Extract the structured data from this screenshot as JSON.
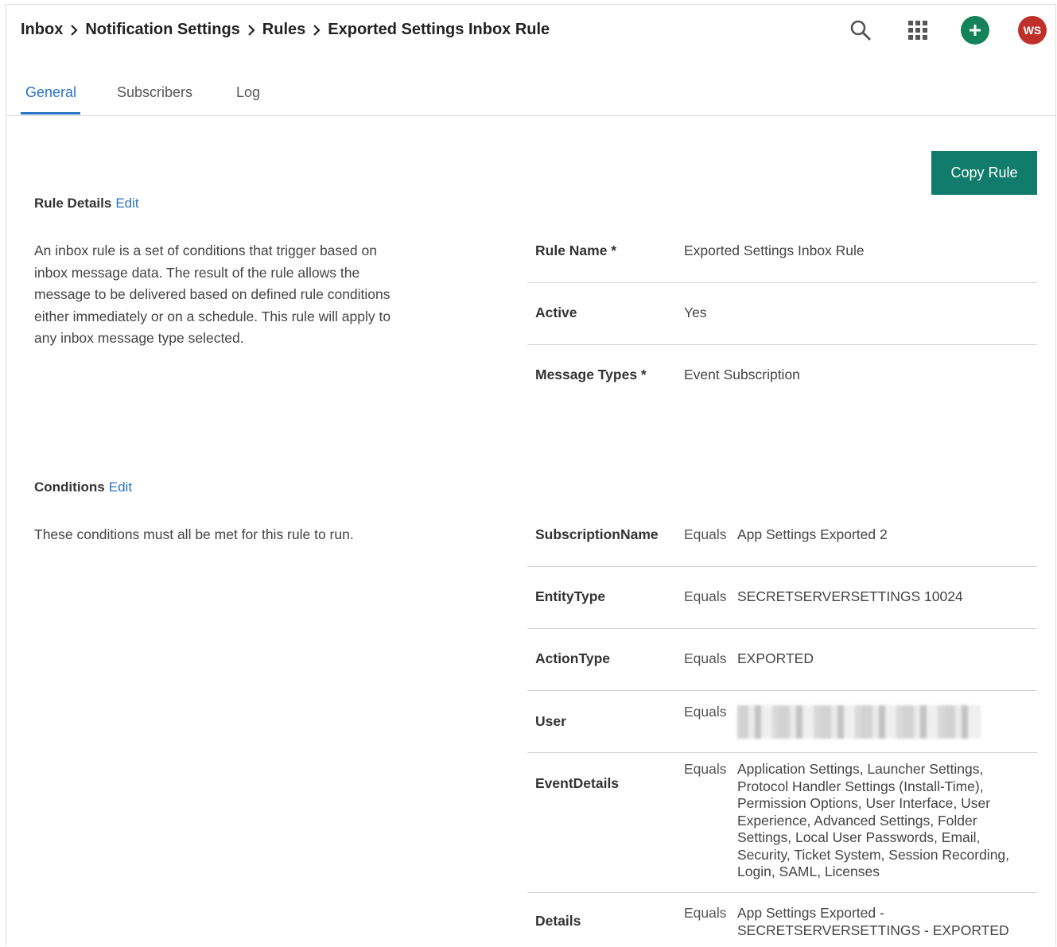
{
  "header": {
    "breadcrumb": [
      "Inbox",
      "Notification Settings",
      "Rules",
      "Exported Settings Inbox Rule"
    ],
    "avatar_initials": "WS",
    "icons": [
      "search-icon",
      "app-grid-icon",
      "add-icon"
    ]
  },
  "tabs": [
    {
      "label": "General",
      "active": true
    },
    {
      "label": "Subscribers",
      "active": false
    },
    {
      "label": "Log",
      "active": false
    }
  ],
  "copy_button": "Copy Rule",
  "rule_details": {
    "title": "Rule Details",
    "edit": "Edit",
    "description_lines": [
      "An inbox rule is a set of conditions that trigger based on",
      "inbox message data. The result of the rule allows the",
      "message to be delivered based on defined rule conditions",
      "either immediately or on a schedule. This rule will apply to",
      "any inbox message type selected."
    ],
    "fields": [
      {
        "label": "Rule Name *",
        "value": "Exported Settings Inbox Rule"
      },
      {
        "label": "Active",
        "value": "Yes"
      },
      {
        "label": "Message Types *",
        "value": "Event Subscription"
      }
    ]
  },
  "conditions": {
    "title": "Conditions",
    "edit": "Edit",
    "description": "These conditions must all be met for this rule to run.",
    "rows": [
      {
        "field": "SubscriptionName",
        "operator": "Equals",
        "value_lines": [
          "App Settings Exported 2"
        ]
      },
      {
        "field": "EntityType",
        "operator": "Equals",
        "value_lines": [
          "SECRETSERVERSETTINGS 10024"
        ]
      },
      {
        "field": "ActionType",
        "operator": "Equals",
        "value_lines": [
          "EXPORTED"
        ]
      },
      {
        "field": "User",
        "operator": "Equals",
        "value_lines": []
      },
      {
        "field": "EventDetails",
        "operator": "Equals",
        "value_lines": [
          "Application Settings, Launcher Settings,",
          "Protocol Handler Settings (Install-Time),",
          "Permission Options, User Interface, User",
          "Experience, Advanced Settings, Folder",
          "Settings, Local User Passwords, Email,",
          "Security, Ticket System, Session Recording,",
          "Login, SAML, Licenses"
        ]
      },
      {
        "field": "Details",
        "operator": "Equals",
        "value_lines": [
          "App Settings Exported -",
          "SECRETSERVERSETTINGS - EXPORTED"
        ]
      }
    ]
  },
  "colors": {
    "accent": "#2a73c4",
    "primary_button": "#127c6c",
    "add_button": "#15825c",
    "avatar": "#c0302b"
  }
}
